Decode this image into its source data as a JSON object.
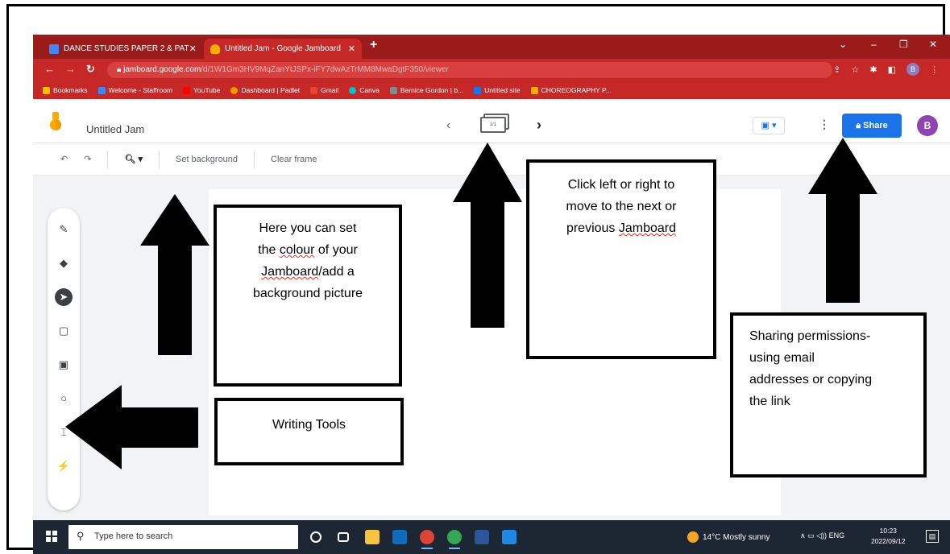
{
  "browser": {
    "tabs": [
      {
        "title": "DANCE STUDIES PAPER 2 & PAT",
        "active": false,
        "favicon_color": "#4285f4"
      },
      {
        "title": "Untitled Jam - Google Jamboard",
        "active": true,
        "favicon_color": "#f9ab00"
      }
    ],
    "new_tab_label": "+",
    "url_host": "jamboard.google.com",
    "url_path": "/d/1W1Gm3HV9MqZanYtJSPx-iFY7dwAzTrMM8MwaDgtF350/viewer",
    "bookmarks": [
      {
        "label": "Bookmarks",
        "color": "#fbbc04"
      },
      {
        "label": "Welcome - Staffroom",
        "color": "#4285f4"
      },
      {
        "label": "YouTube",
        "color": "#ff0000"
      },
      {
        "label": "Dashboard | Padlet",
        "color": "#f29900"
      },
      {
        "label": "Gmail",
        "color": "#ea4335"
      },
      {
        "label": "Canva",
        "color": "#00c4cc"
      },
      {
        "label": "Bernice Gordon | b...",
        "color": "#888888"
      },
      {
        "label": "Untitled site",
        "color": "#1a73e8"
      },
      {
        "label": "CHOREOGRAPHY P...",
        "color": "#f9ab00"
      }
    ],
    "profile_initial": "B"
  },
  "jamboard": {
    "title": "Untitled Jam",
    "frame_counter": "1/1",
    "share_label": "Share",
    "avatar_initial": "B",
    "toolbar": {
      "set_background": "Set background",
      "clear_frame": "Clear frame"
    },
    "tools": [
      "pen-icon",
      "eraser-icon",
      "select-icon",
      "sticky-note-icon",
      "image-icon",
      "circle-icon",
      "text-box-icon",
      "laser-icon"
    ]
  },
  "annotations": {
    "background": [
      "Here you can set",
      "the colour of your",
      "Jamboard/add a",
      "background picture"
    ],
    "frames": [
      "Click left or right to",
      "move to the next or",
      "previous Jamboard"
    ],
    "sharing": [
      "Sharing permissions-",
      "using email",
      "addresses or copying",
      "the link"
    ],
    "writing_tools": "Writing Tools"
  },
  "taskbar": {
    "search_placeholder": "Type here to search",
    "weather": "14°C  Mostly sunny",
    "language": "ENG",
    "time": "10:23",
    "date": "2022/09/12"
  },
  "colors": {
    "chrome_dark": "#9b1b1b",
    "chrome": "#c62828",
    "share_blue": "#1a73e8",
    "avatar_purple": "#8e44ad",
    "taskbar": "#1c2733"
  }
}
